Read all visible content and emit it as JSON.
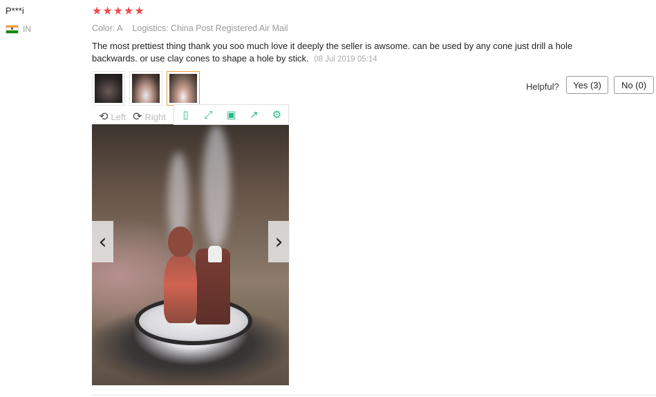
{
  "reviewer": {
    "name": "P***i",
    "country_code": "IN",
    "flag_icon": "india-flag-icon"
  },
  "rating": {
    "stars": 5,
    "max": 5,
    "star_color": "#f44a4a"
  },
  "meta": {
    "color": "Color: A",
    "logistics": "Logistics: China Post Registered Air Mail"
  },
  "review": {
    "text": "The most prettiest thing thank you soo much love it deeply the seller is awsome. can be used by any cone just drill a hole backwards. or use clay cones to shape a hole by stick.",
    "date": "08 Jul 2019 05:14"
  },
  "helpful": {
    "label": "Helpful?",
    "yes_label": "Yes (3)",
    "no_label": "No (0)"
  },
  "thumbnails": [
    {
      "name": "photo-1",
      "active": false
    },
    {
      "name": "photo-2",
      "active": false
    },
    {
      "name": "photo-3",
      "active": true
    }
  ],
  "viewer": {
    "rotate_left_label": "Left",
    "rotate_right_label": "Right",
    "tools": [
      "fit-screen-icon",
      "fullscreen-icon",
      "save-icon",
      "share-icon",
      "settings-icon"
    ],
    "accent": "#2bb88a",
    "prev_arrow": "‹",
    "next_arrow": "›"
  }
}
